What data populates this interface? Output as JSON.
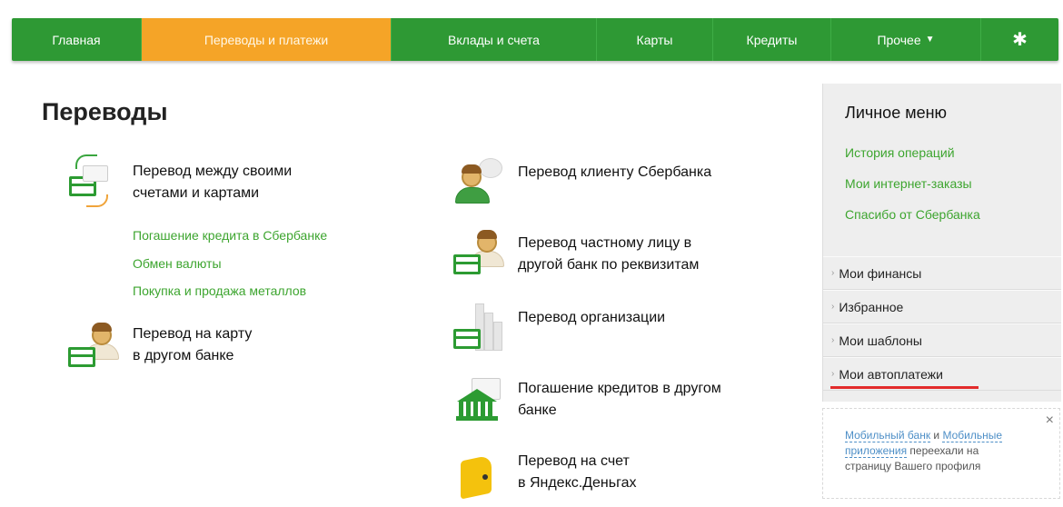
{
  "nav": {
    "items": [
      {
        "label": "Главная"
      },
      {
        "label": "Переводы и платежи"
      },
      {
        "label": "Вклады и счета"
      },
      {
        "label": "Карты"
      },
      {
        "label": "Кредиты"
      },
      {
        "label": "Прочее"
      }
    ],
    "settings_icon": "gear-icon"
  },
  "main": {
    "title": "Переводы",
    "own_accounts": {
      "line1": "Перевод между своими",
      "line2": "счетами и картами"
    },
    "sublinks": [
      "Погашение кредита в Сбербанке",
      "Обмен валюты",
      "Покупка и продажа металлов"
    ],
    "card_other_bank": {
      "line1": "Перевод на карту",
      "line2": "в другом банке"
    },
    "to_client": {
      "line1": "Перевод клиенту Сбербанка"
    },
    "to_person": {
      "line1": "Перевод частному лицу в",
      "line2": "другой банк по реквизитам"
    },
    "to_org": {
      "line1": "Перевод организации"
    },
    "loans_other": {
      "line1": "Погашение кредитов в другом",
      "line2": "банке"
    },
    "yandex": {
      "line1": "Перевод на счет",
      "line2": "в Яндекс.Деньгах"
    }
  },
  "sidebar": {
    "title": "Личное меню",
    "links": [
      "История операций",
      "Мои интернет-заказы",
      "Спасибо от Сбербанка"
    ],
    "rows": [
      "Мои финансы",
      "Избранное",
      "Мои шаблоны",
      "Мои автоплатежи"
    ]
  },
  "notice": {
    "link1": "Мобильный банк",
    "and": " и ",
    "link2": "Мобильные приложения",
    "rest": " переехали на страницу Вашего профиля",
    "close": "×"
  },
  "colors": {
    "nav_bg": "#2e9934",
    "nav_active": "#f5a427",
    "link": "#3da52f",
    "highlight_underline": "#e22b2b"
  }
}
